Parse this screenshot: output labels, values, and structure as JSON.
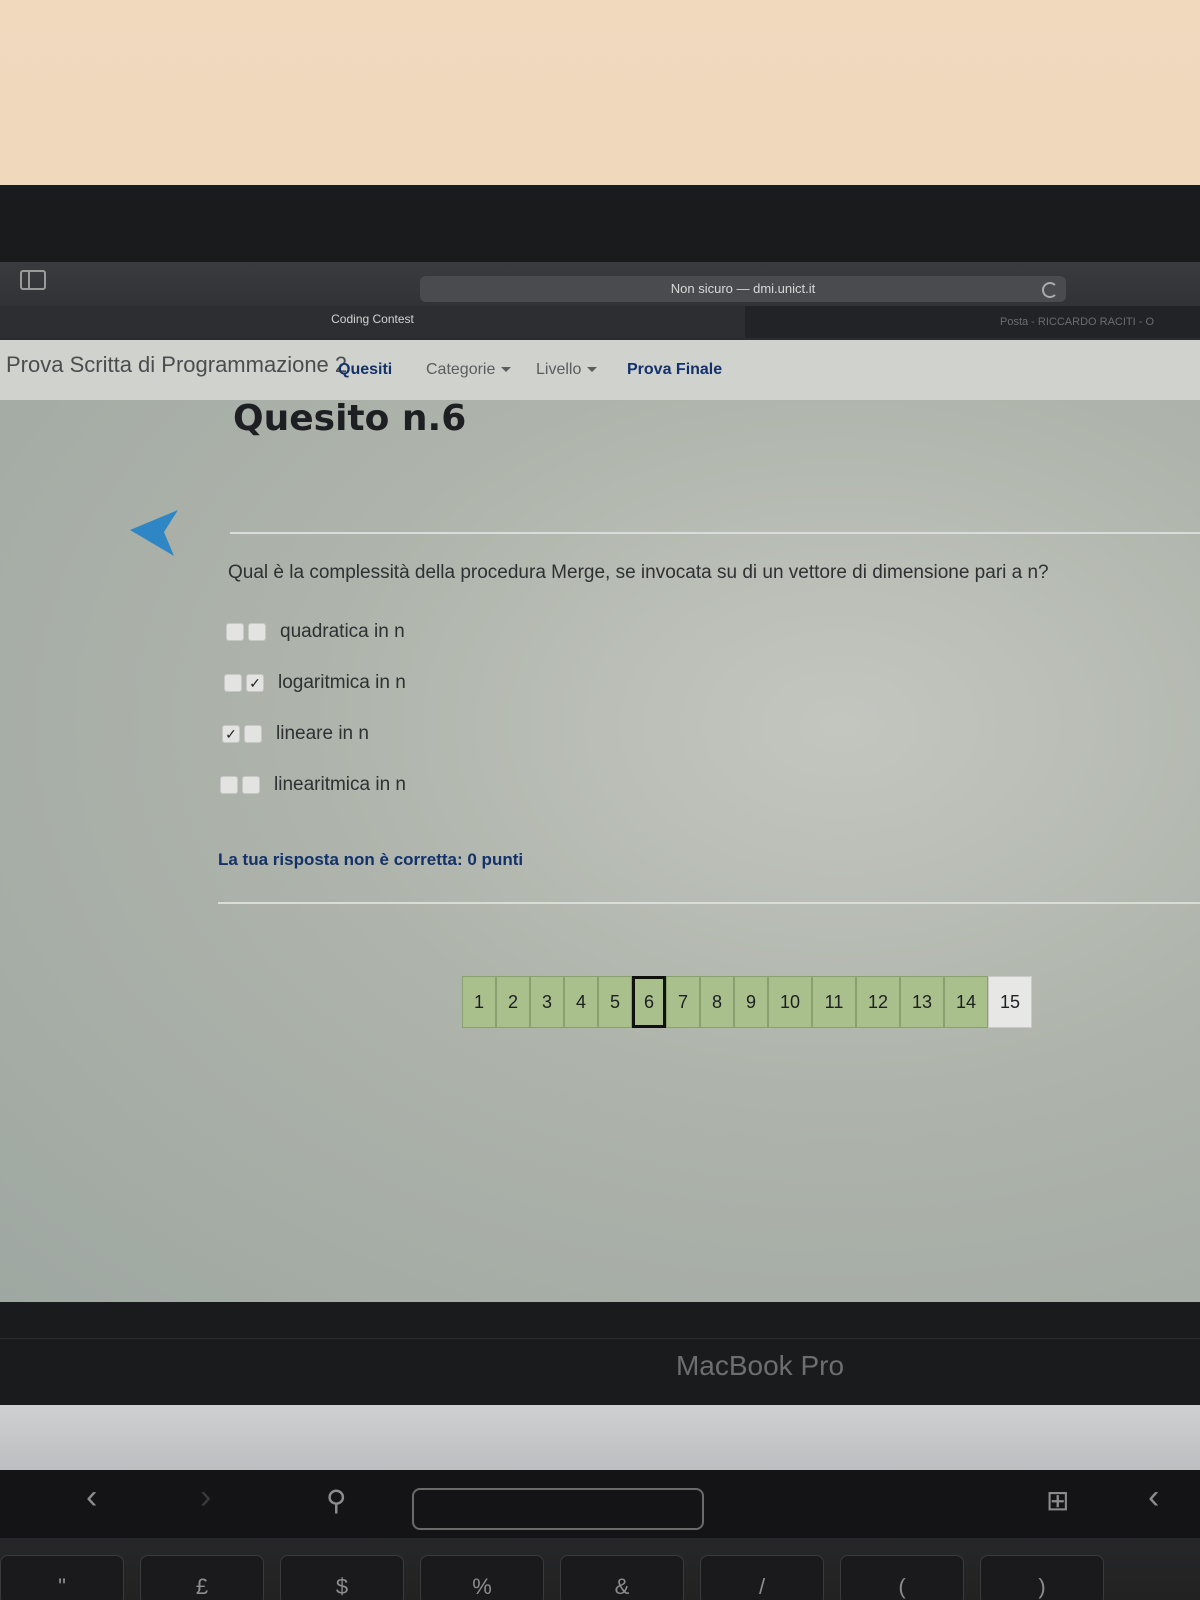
{
  "browser": {
    "url": "Non sicuro — dmi.unict.it",
    "tab_active": "Coding Contest",
    "tab_right": "Posta - RICCARDO RACITI - O"
  },
  "navbar": {
    "brand": "Prova Scritta di Programmazione 2",
    "items": [
      {
        "label": "Quesiti"
      },
      {
        "label": "Categorie"
      },
      {
        "label": "Livello"
      },
      {
        "label": "Prova Finale"
      }
    ]
  },
  "quiz": {
    "title": "Quesito n.6",
    "question": "Qual è la complessità della procedura Merge, se invocata su di un vettore di dimensione pari a n?",
    "options": [
      {
        "label": "quadratica in n",
        "box1": "",
        "box2": ""
      },
      {
        "label": "logaritmica in n",
        "box1": "",
        "box2": "✓"
      },
      {
        "label": "lineare in n",
        "box1": "✓",
        "box2": ""
      },
      {
        "label": "linearitmica in n",
        "box1": "",
        "box2": ""
      }
    ],
    "feedback": "La tua risposta non è corretta: 0 punti"
  },
  "pagination": {
    "pages": [
      "1",
      "2",
      "3",
      "4",
      "5",
      "6",
      "7",
      "8",
      "9",
      "10",
      "11",
      "12",
      "13",
      "14",
      "15"
    ],
    "current": "6"
  },
  "bezel": {
    "label": "MacBook Pro"
  },
  "keyboard": {
    "keys": [
      "\"",
      "£",
      "$",
      "%",
      "&",
      "/",
      "(",
      ")"
    ]
  },
  "colors": {
    "nav_active": "#13316a",
    "pager_green": "#a9bf8c",
    "back_arrow": "#2f86c4"
  }
}
